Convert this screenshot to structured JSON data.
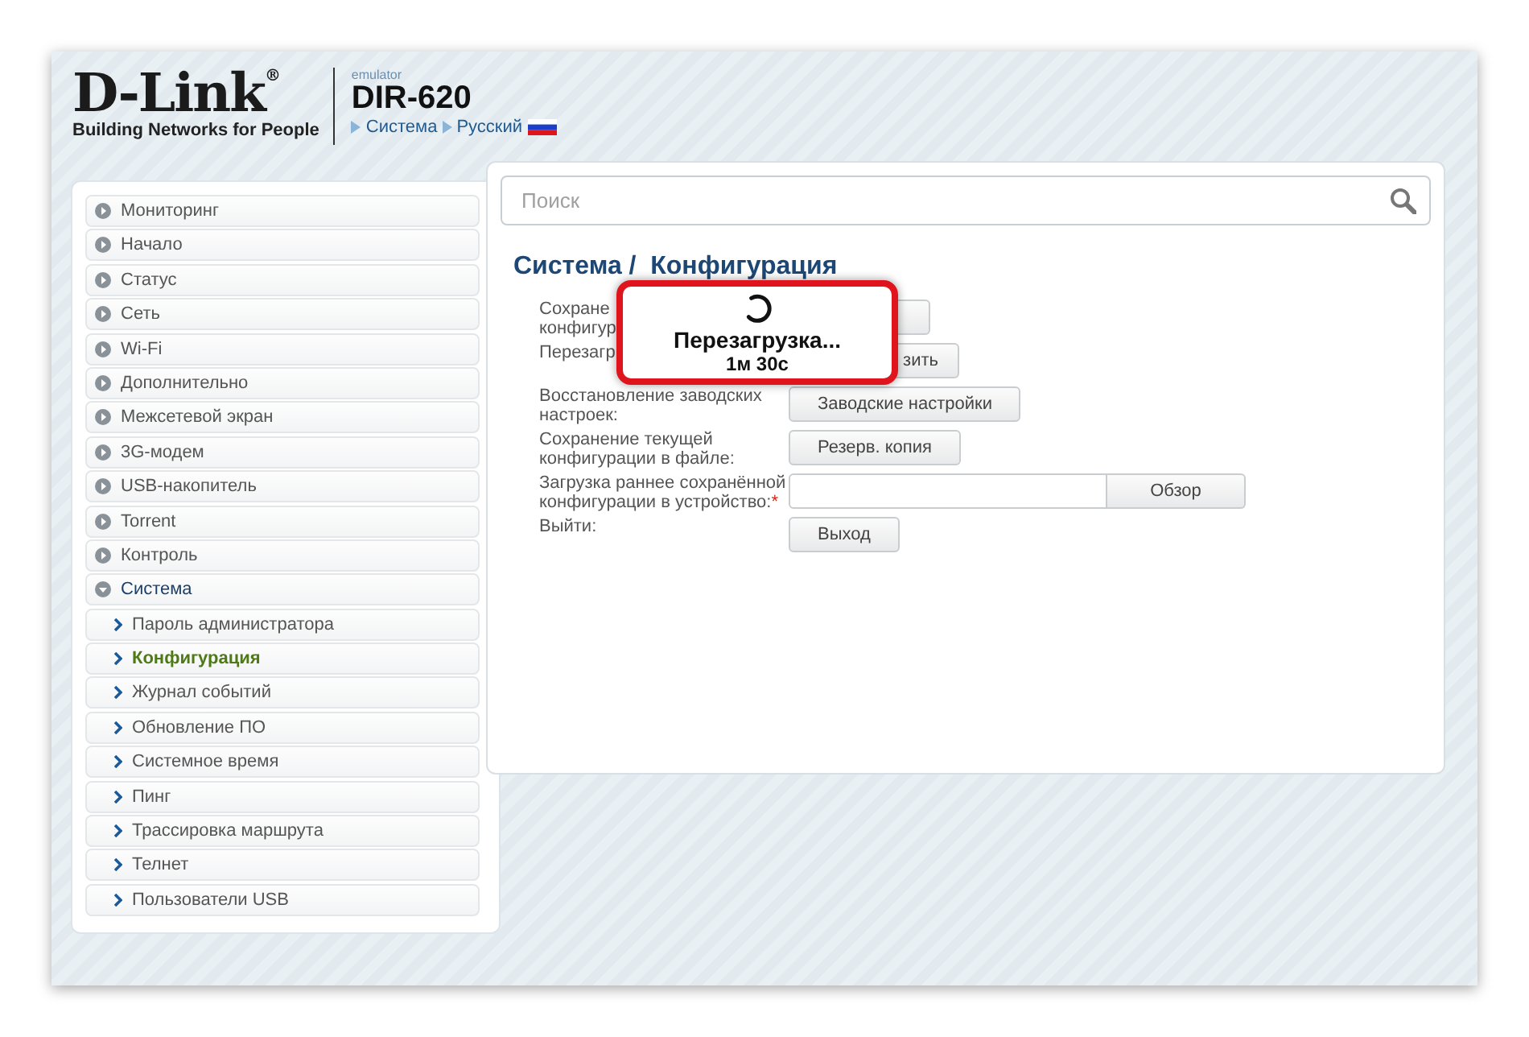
{
  "header": {
    "logo": "D-Link",
    "logo_mark": "®",
    "tagline": "Building Networks for People",
    "emulator_label": "emulator",
    "model": "DIR-620",
    "breadcrumb": [
      {
        "label": "Система"
      },
      {
        "label": "Русский"
      }
    ]
  },
  "sidebar": {
    "items": [
      {
        "label": "Мониторинг",
        "expanded": false
      },
      {
        "label": "Начало",
        "expanded": false
      },
      {
        "label": "Статус",
        "expanded": false
      },
      {
        "label": "Сеть",
        "expanded": false
      },
      {
        "label": "Wi-Fi",
        "expanded": false
      },
      {
        "label": "Дополнительно",
        "expanded": false
      },
      {
        "label": "Межсетевой экран",
        "expanded": false
      },
      {
        "label": "3G-модем",
        "expanded": false
      },
      {
        "label": "USB-накопитель",
        "expanded": false
      },
      {
        "label": "Torrent",
        "expanded": false
      },
      {
        "label": "Контроль",
        "expanded": false
      },
      {
        "label": "Система",
        "expanded": true,
        "children": [
          {
            "label": "Пароль администратора",
            "selected": false
          },
          {
            "label": "Конфигурация",
            "selected": true
          },
          {
            "label": "Журнал событий",
            "selected": false
          },
          {
            "label": "Обновление ПО",
            "selected": false
          },
          {
            "label": "Системное время",
            "selected": false
          },
          {
            "label": "Пинг",
            "selected": false
          },
          {
            "label": "Трассировка маршрута",
            "selected": false
          },
          {
            "label": "Телнет",
            "selected": false
          },
          {
            "label": "Пользователи USB",
            "selected": false
          }
        ]
      }
    ]
  },
  "search": {
    "placeholder": "Поиск"
  },
  "page_title": "Система /  Конфигурация",
  "form_rows": [
    {
      "kind": "button",
      "label": "Сохране\nконфигур"
    },
    {
      "kind": "clipped_button",
      "label": "Перезагр",
      "button": "зить"
    },
    {
      "kind": "button",
      "label": "Восстановление заводских настроек:",
      "button": "Заводские настройки"
    },
    {
      "kind": "button",
      "label": "Сохранение текущей конфигурации в файле:",
      "button": "Резерв. копия"
    },
    {
      "kind": "file",
      "label": "Загрузка раннее сохранённой конфигурации в устройство:",
      "required_mark": "*",
      "button": "Обзор"
    },
    {
      "kind": "button",
      "label": "Выйти:",
      "button": "Выход"
    }
  ],
  "modal": {
    "message": "Перезагрузка...",
    "timer": "1м 30с"
  }
}
